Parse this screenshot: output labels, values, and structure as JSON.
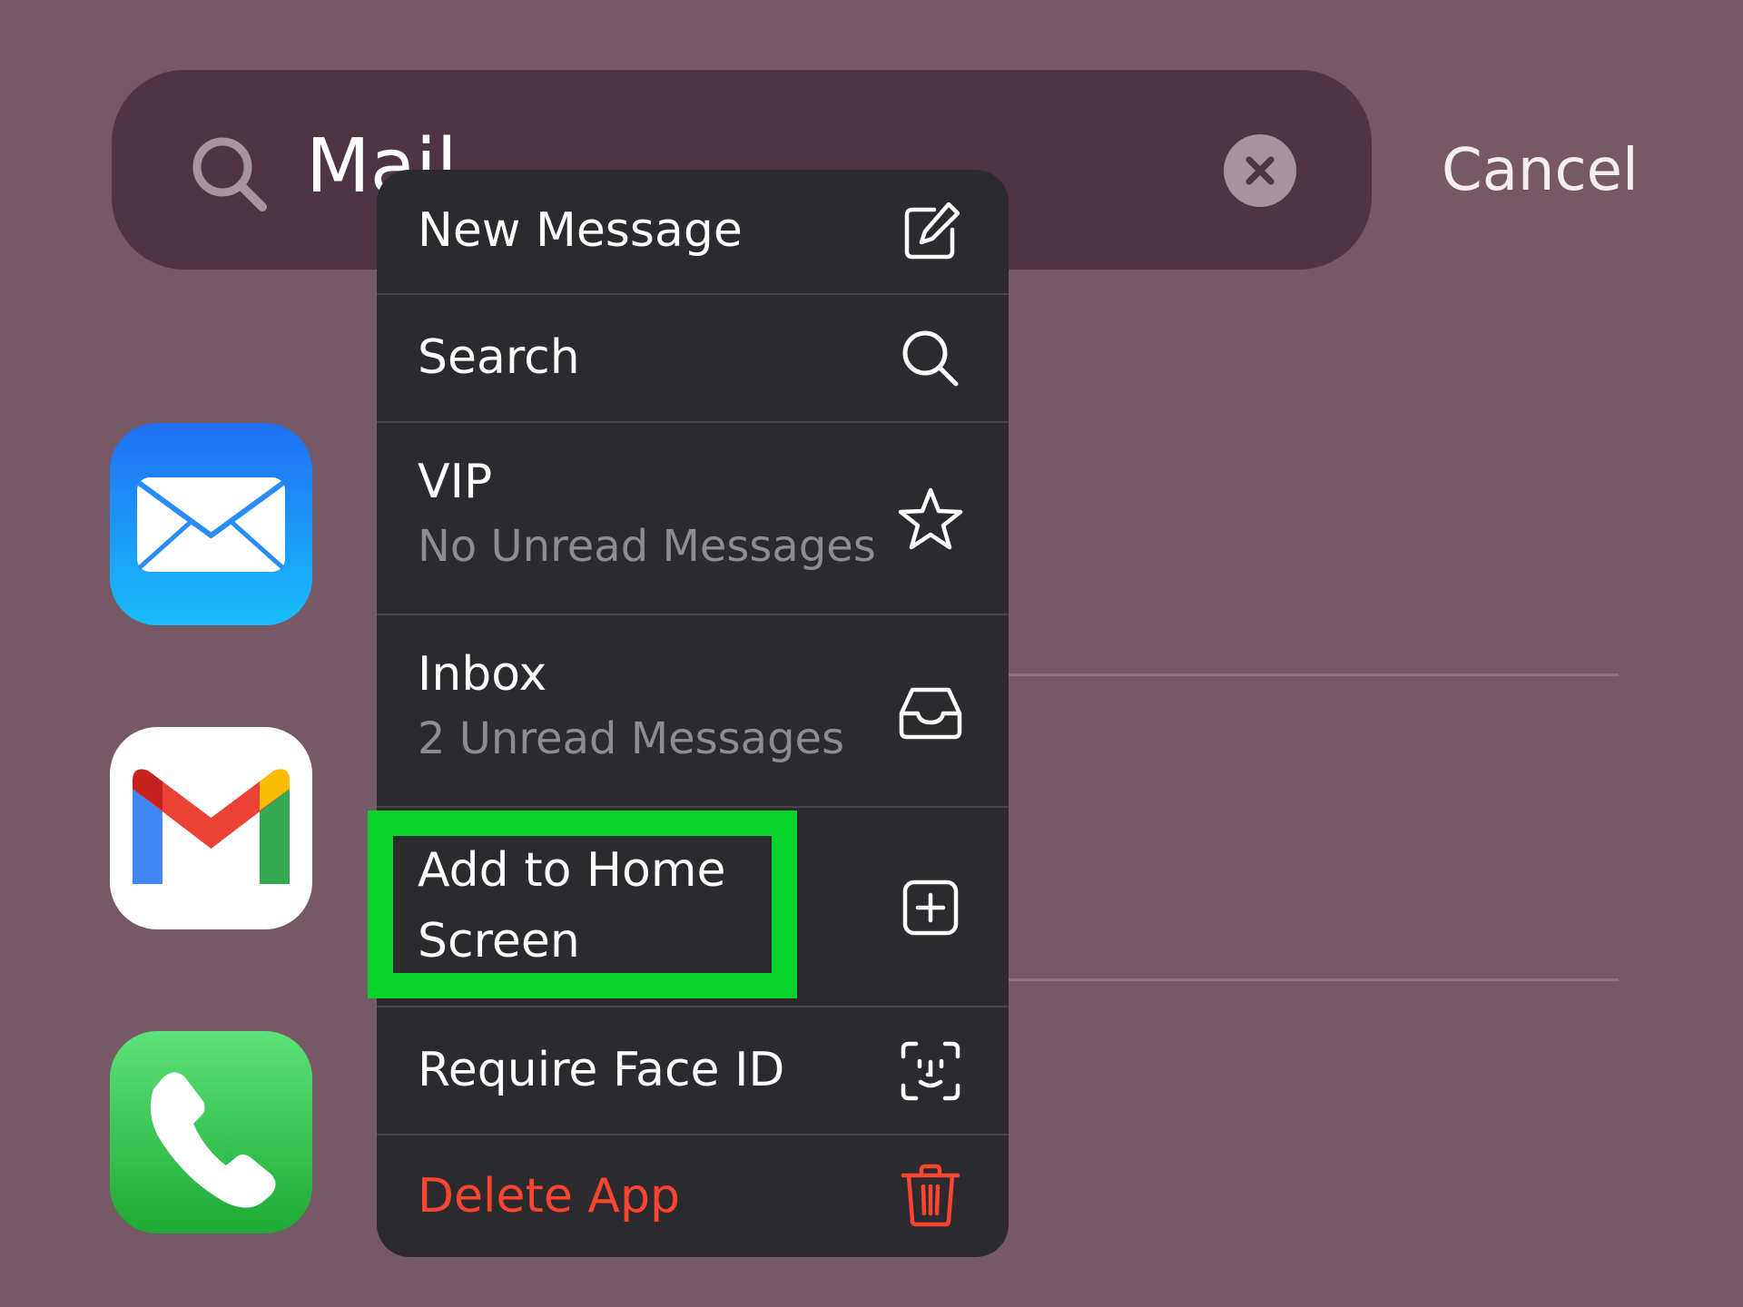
{
  "search": {
    "query": "Mail",
    "search_icon": "search-icon",
    "clear_icon": "clear-x-icon",
    "cancel_label": "Cancel"
  },
  "apps": [
    {
      "name": "Mail",
      "icon": "mail-app-icon",
      "color": "#1a8cf5"
    },
    {
      "name": "Gmail",
      "icon": "gmail-app-icon",
      "color": "#ffffff"
    },
    {
      "name": "Phone",
      "icon": "phone-app-icon",
      "color": "#2fc852"
    }
  ],
  "menu": {
    "items": [
      {
        "title": "New Message",
        "icon": "compose-icon"
      },
      {
        "title": "Search",
        "icon": "search-icon"
      },
      {
        "title": "VIP",
        "subtitle": "No Unread Messages",
        "icon": "star-icon"
      },
      {
        "title": "Inbox",
        "subtitle": "2 Unread Messages",
        "icon": "inbox-tray-icon"
      },
      {
        "title_line1": "Add to Home",
        "title_line2": "Screen",
        "icon": "plus-square-icon"
      },
      {
        "title": "Require Face ID",
        "icon": "face-id-icon"
      },
      {
        "title": "Delete App",
        "icon": "trash-icon",
        "color": "#ff4530"
      }
    ]
  },
  "annotation": {
    "highlight_color": "#0bd32d",
    "target": "Add to Home Screen"
  },
  "colors": {
    "background": "#775865",
    "search_bar": "#4f3544",
    "menu": "#2b2a2f"
  }
}
